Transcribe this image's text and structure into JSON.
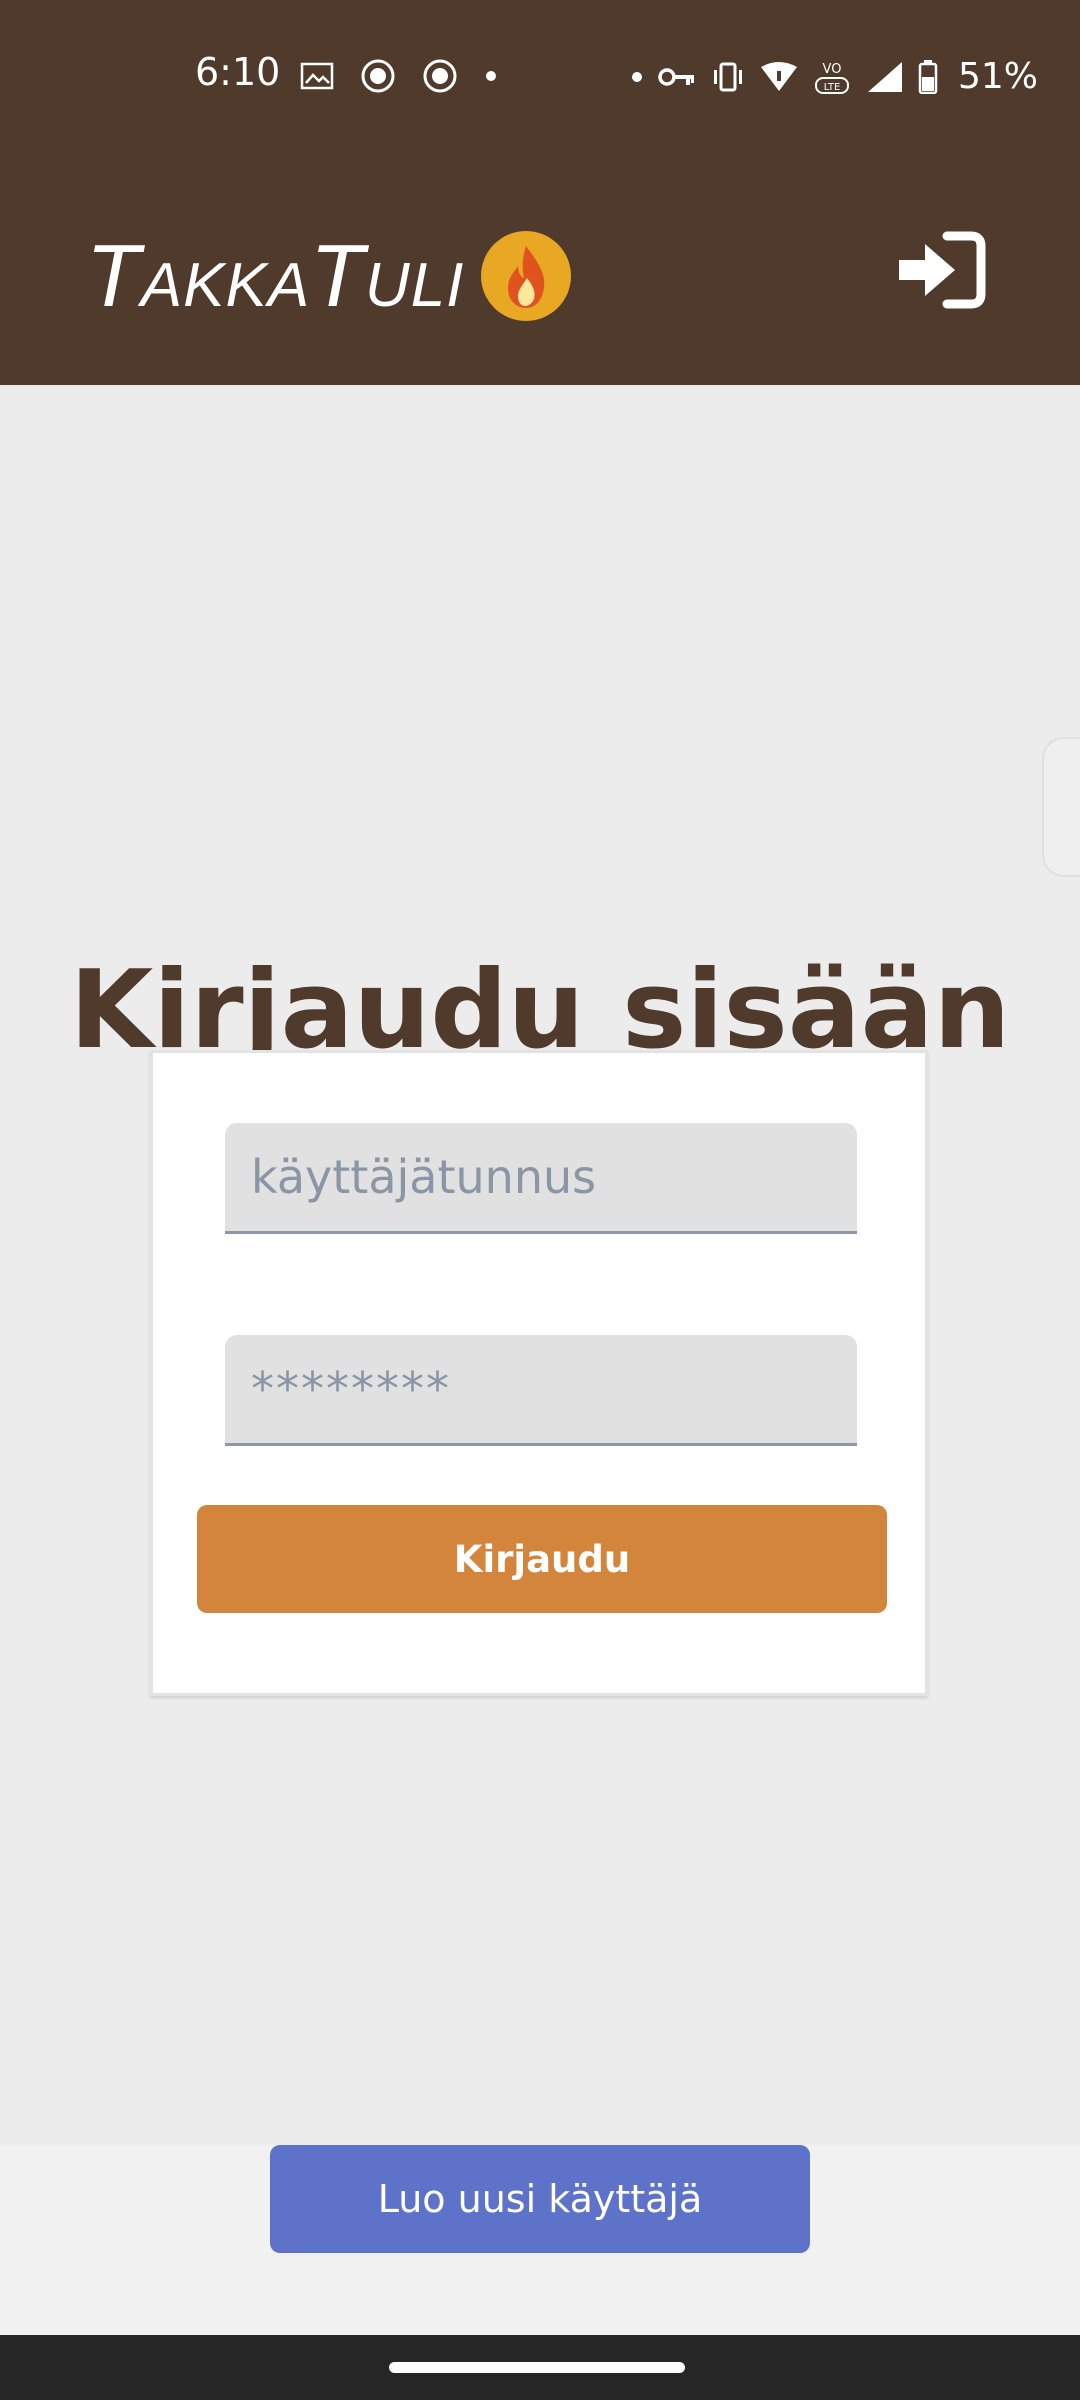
{
  "status_bar": {
    "time": "6:10",
    "battery_percent": "51%",
    "left_icons": [
      "image-icon",
      "duckduckgo-icon",
      "duckduckgo-icon",
      "notification-dot-icon"
    ],
    "right_icons": [
      "dot-icon",
      "vpn-key-icon",
      "vibrate-icon",
      "wifi-icon",
      "volte-icon",
      "signal-icon",
      "battery-icon"
    ]
  },
  "header": {
    "logo_text": "TakkaTuli",
    "login_icon": "sign-in-icon"
  },
  "main": {
    "title": "Kirjaudu sisään",
    "username_placeholder": "käyttäjätunnus",
    "password_placeholder": "********",
    "login_button_label": "Kirjaudu"
  },
  "footer": {
    "create_user_label": "Luo uusi käyttäjä"
  },
  "colors": {
    "header_brown": "#4f3a2c",
    "login_orange": "#d4853c",
    "create_blue": "#5d72c8",
    "flame_yellow": "#e8a823"
  }
}
